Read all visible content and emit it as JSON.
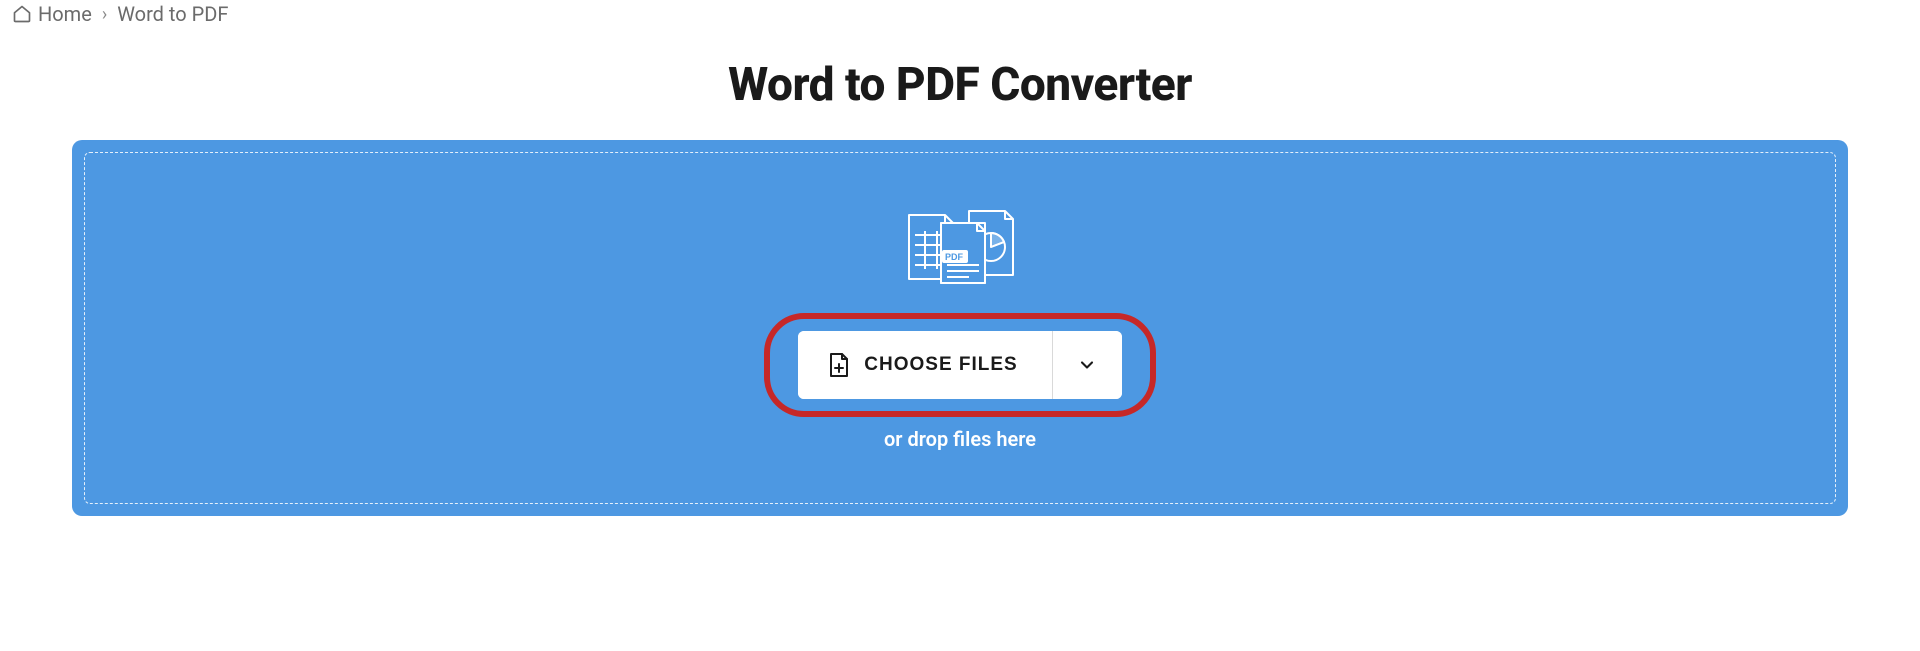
{
  "breadcrumb": {
    "home_label": "Home",
    "current_label": "Word to PDF",
    "separator": "›"
  },
  "page": {
    "title": "Word to PDF Converter"
  },
  "uploader": {
    "choose_label": "CHOOSE FILES",
    "drop_hint": "or drop files here"
  }
}
